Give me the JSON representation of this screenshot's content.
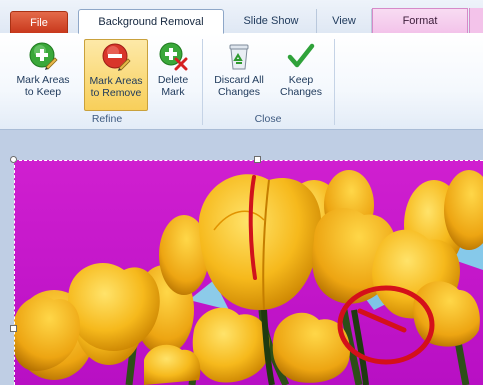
{
  "tabs": {
    "file": "File",
    "background_removal": "Background Removal",
    "slide_show": "Slide Show",
    "view": "View",
    "format": "Format"
  },
  "ribbon": {
    "refine": {
      "label": "Refine",
      "mark_keep": "Mark Areas\nto Keep",
      "mark_remove": "Mark Areas\nto Remove",
      "delete_mark": "Delete\nMark"
    },
    "close": {
      "label": "Close",
      "discard": "Discard All\nChanges",
      "keep": "Keep\nChanges"
    }
  },
  "icons": {
    "mark_keep": "green-plus-pencil-icon",
    "mark_remove": "red-minus-pencil-icon",
    "delete_mark": "delete-mark-icon",
    "discard": "recycle-bin-icon",
    "keep": "checkmark-icon"
  },
  "colors": {
    "removed_background": "#cc11cc",
    "file_tab": "#d2462a",
    "format_tab": "#f3c3ea",
    "active_button": "#f8cf5a"
  }
}
